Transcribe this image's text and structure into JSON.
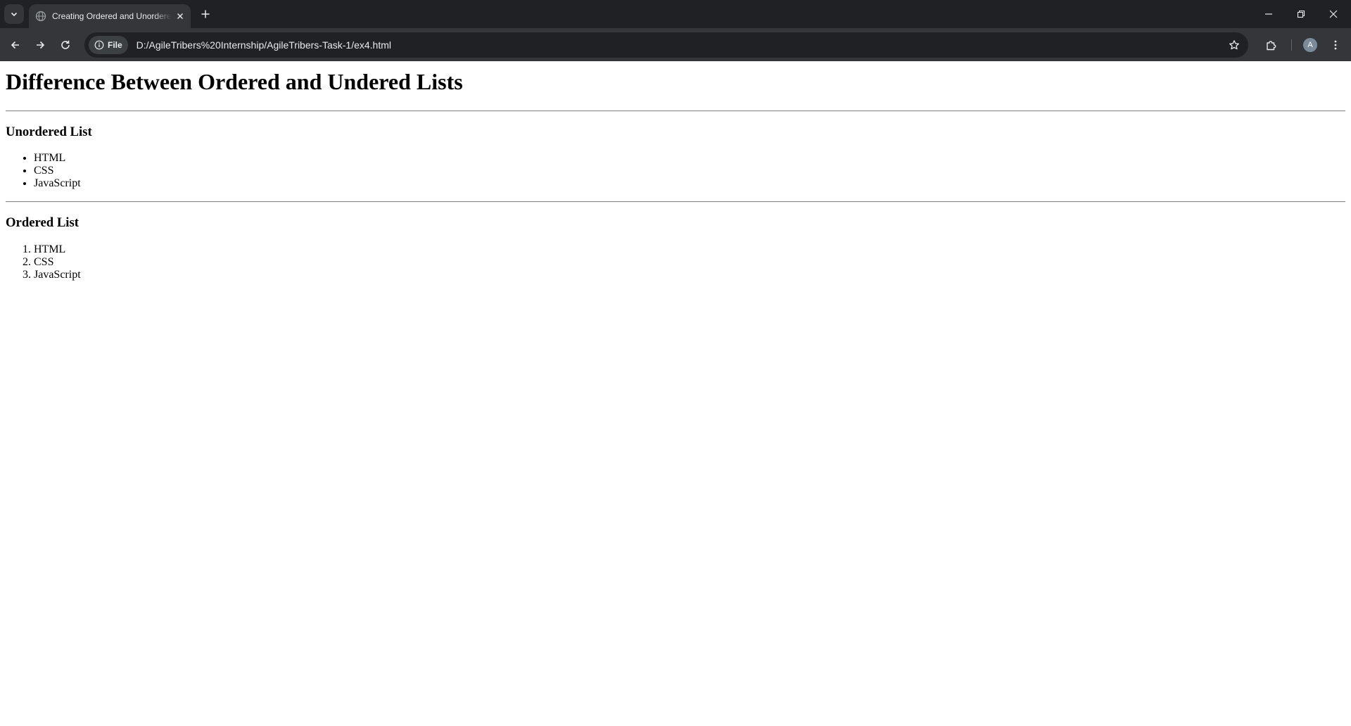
{
  "browser": {
    "tab_title": "Creating Ordered and Unordered Lists",
    "chip_label": "File",
    "url": "D:/AgileTribers%20Internship/AgileTribers-Task-1/ex4.html",
    "avatar_letter": "A"
  },
  "page": {
    "heading": "Difference Between Ordered and Undered Lists",
    "unordered": {
      "title": "Unordered List",
      "items": [
        "HTML",
        "CSS",
        "JavaScript"
      ]
    },
    "ordered": {
      "title": "Ordered List",
      "items": [
        "HTML",
        "CSS",
        "JavaScript"
      ]
    }
  },
  "colors": {
    "chrome_dark": "#202124",
    "chrome_toolbar": "#35363a",
    "page_bg": "#ffffff"
  }
}
